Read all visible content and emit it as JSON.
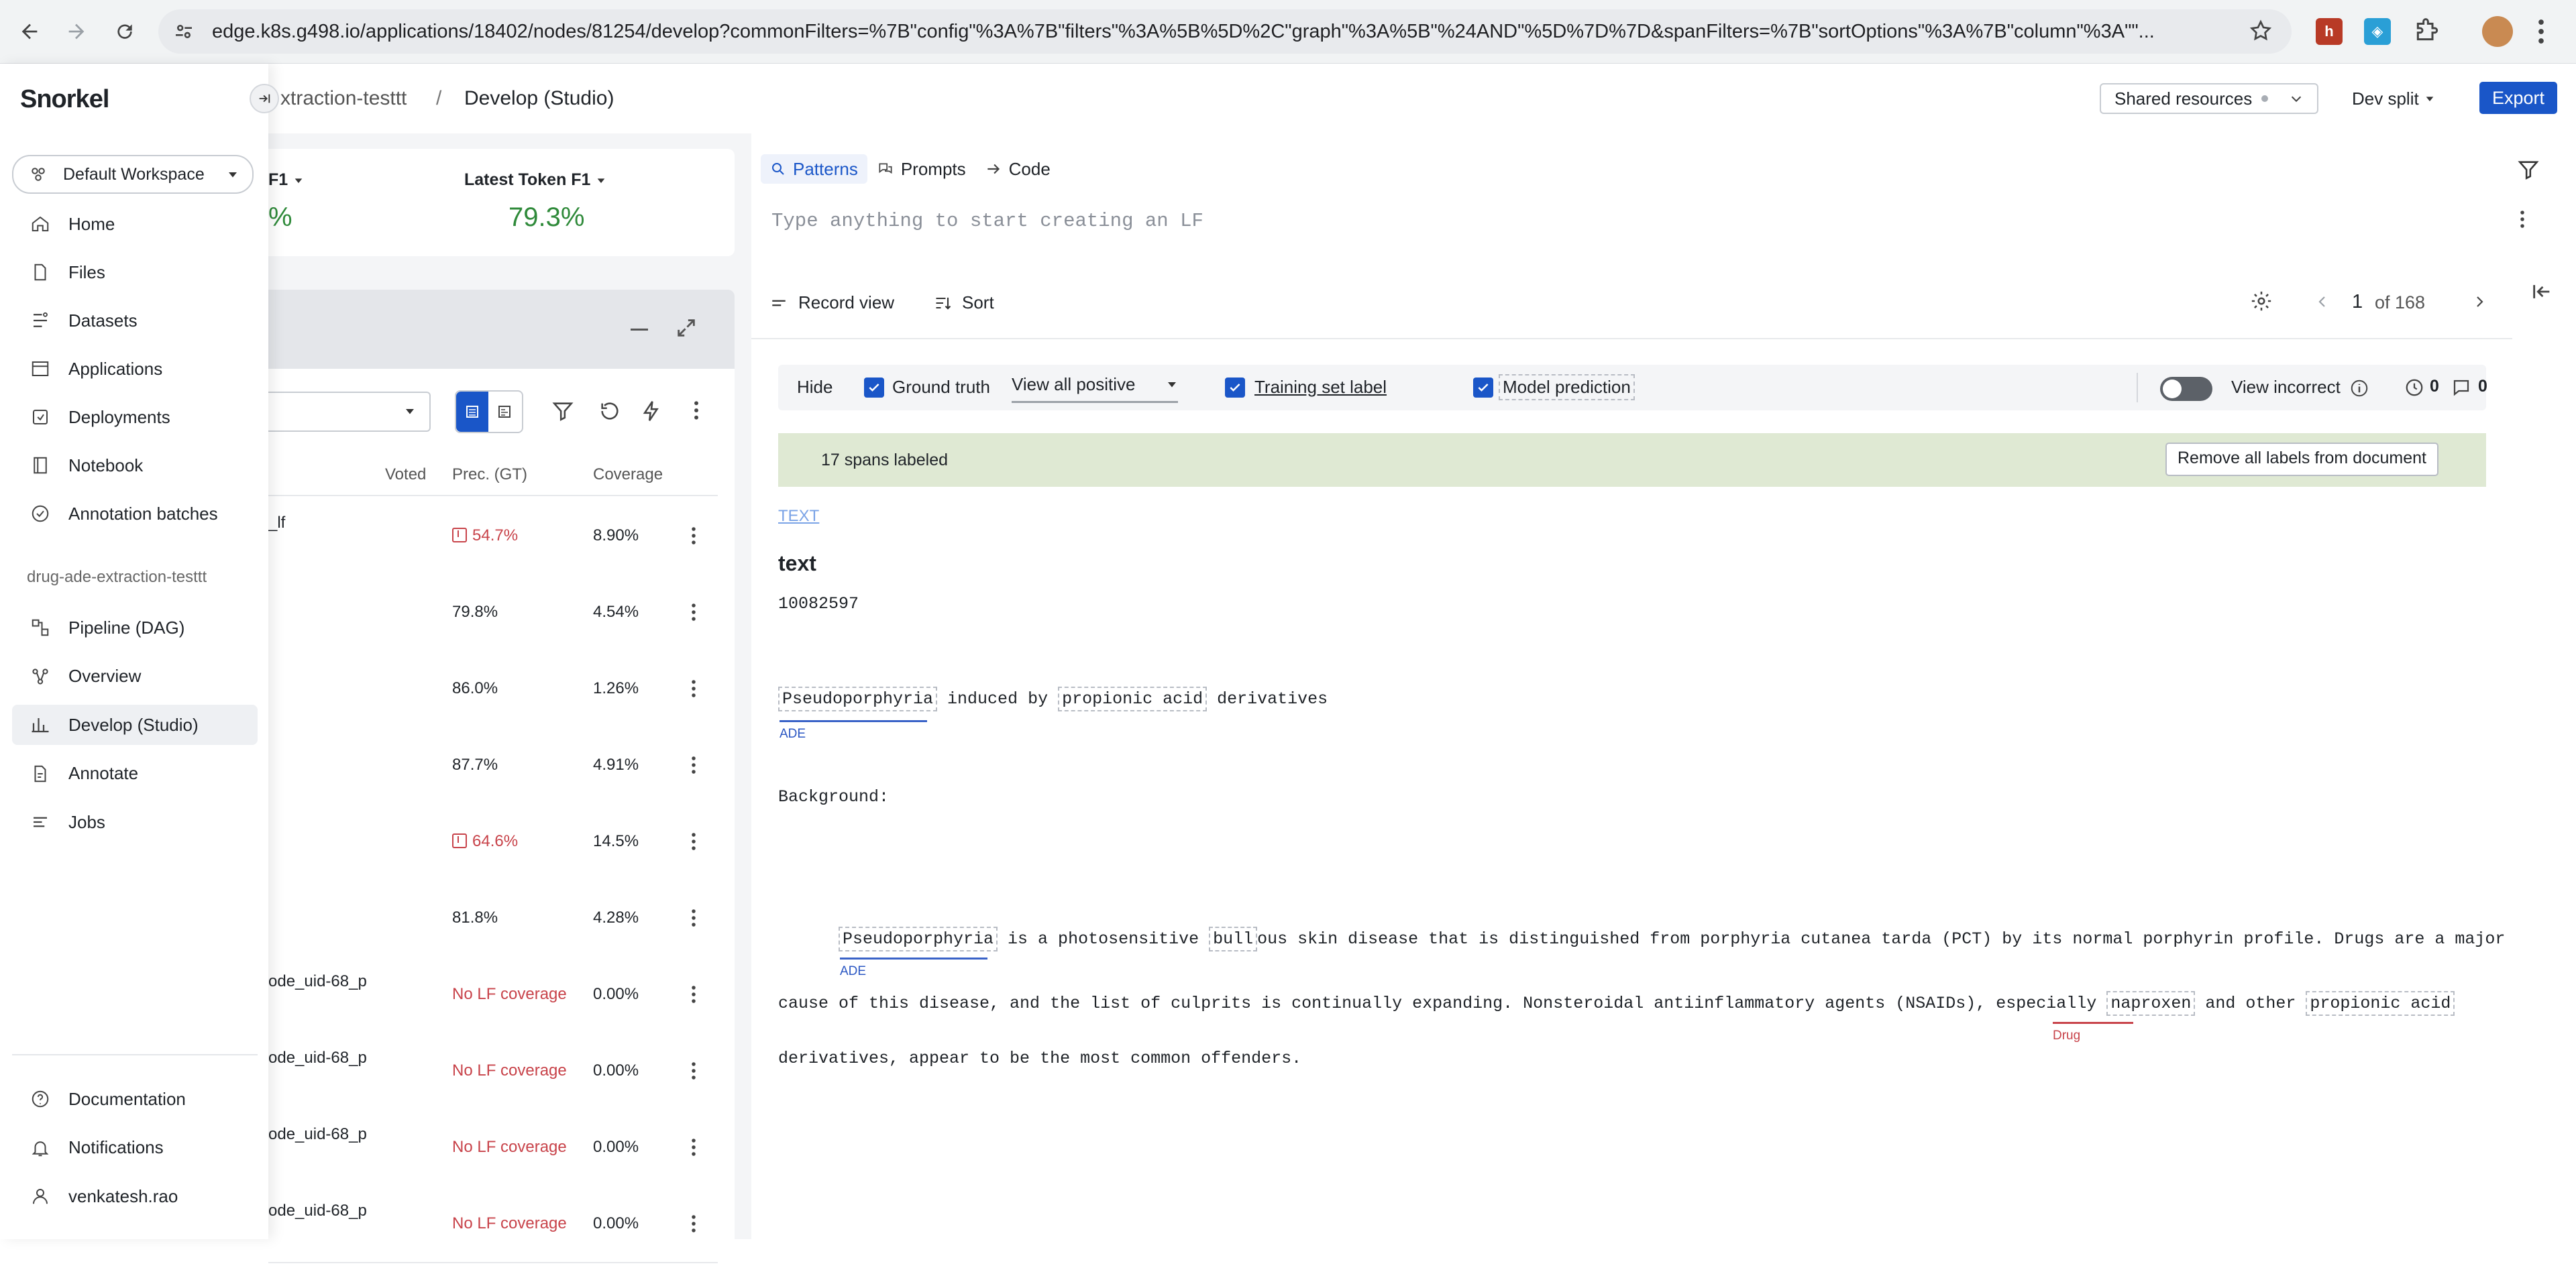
{
  "browser": {
    "url": "edge.k8s.g498.io/applications/18402/nodes/81254/develop?commonFilters=%7B\"config\"%3A%7B\"filters\"%3A%5B%5D%2C\"graph\"%3A%5B\"%24AND\"%5D%7D%7D&spanFilters=%7B\"sortOptions\"%3A%7B\"column\"%3A\"\"..."
  },
  "brand": {
    "logo": "Snorkel"
  },
  "header": {
    "breadcrumb_parent": "xtraction-testtt",
    "separator": "/",
    "breadcrumb_current": "Develop (Studio)",
    "shared_resources": "Shared resources",
    "split": "Dev split",
    "export": "Export"
  },
  "sidenav": {
    "workspace": "Default Workspace",
    "items": [
      {
        "label": "Home",
        "icon": "home-icon"
      },
      {
        "label": "Files",
        "icon": "file-icon"
      },
      {
        "label": "Datasets",
        "icon": "datasets-icon"
      },
      {
        "label": "Applications",
        "icon": "window-icon"
      },
      {
        "label": "Deployments",
        "icon": "deploy-icon"
      },
      {
        "label": "Notebook",
        "icon": "notebook-icon"
      },
      {
        "label": "Annotation batches",
        "icon": "check-circle-icon"
      }
    ],
    "app_name": "drug-ade-extraction-testtt",
    "app_items": [
      {
        "label": "Pipeline (DAG)",
        "icon": "dag-icon"
      },
      {
        "label": "Overview",
        "icon": "overview-icon"
      },
      {
        "label": "Develop (Studio)",
        "icon": "develop-icon",
        "active": true
      },
      {
        "label": "Annotate",
        "icon": "annotate-icon"
      },
      {
        "label": "Jobs",
        "icon": "jobs-icon"
      }
    ],
    "footer": [
      {
        "label": "Documentation",
        "icon": "help-icon"
      },
      {
        "label": "Notifications",
        "icon": "bell-icon"
      },
      {
        "label": "venkatesh.rao",
        "icon": "user-icon"
      }
    ]
  },
  "metrics": {
    "first_label": "F1",
    "first_value": "%",
    "latest_label": "Latest Token F1",
    "latest_value": "79.3%"
  },
  "lf_table": {
    "columns": [
      "Voted",
      "Prec. (GT)",
      "Coverage"
    ],
    "rows": [
      {
        "name": "_lf",
        "voted": "",
        "precision": "54.7%",
        "coverage": "8.90%",
        "warn": true
      },
      {
        "name": "",
        "voted": "",
        "precision": "79.8%",
        "coverage": "4.54%",
        "warn": false
      },
      {
        "name": "",
        "voted": "",
        "precision": "86.0%",
        "coverage": "1.26%",
        "warn": false
      },
      {
        "name": "",
        "voted": "",
        "precision": "87.7%",
        "coverage": "4.91%",
        "warn": false
      },
      {
        "name": "",
        "voted": "",
        "precision": "64.6%",
        "coverage": "14.5%",
        "warn": true
      },
      {
        "name": "",
        "voted": "",
        "precision": "81.8%",
        "coverage": "4.28%",
        "warn": false
      },
      {
        "name": "ode_uid-68_p",
        "voted": "",
        "precision": "No LF coverage",
        "coverage": "0.00%",
        "warn": false,
        "none": true
      },
      {
        "name": "ode_uid-68_p",
        "voted": "",
        "precision": "No LF coverage",
        "coverage": "0.00%",
        "warn": false,
        "none": true
      },
      {
        "name": "ode_uid-68_p",
        "voted": "",
        "precision": "No LF coverage",
        "coverage": "0.00%",
        "warn": false,
        "none": true
      },
      {
        "name": "ode_uid-68_p",
        "voted": "",
        "precision": "No LF coverage",
        "coverage": "0.00%",
        "warn": false,
        "none": true
      }
    ]
  },
  "lf_builder": {
    "tabs": [
      "Patterns",
      "Prompts",
      "Code"
    ],
    "placeholder": "Type anything to start creating an LF"
  },
  "record": {
    "record_view": "Record view",
    "sort": "Sort",
    "page": "1",
    "of": "of 168",
    "hide": "Hide",
    "ground_truth": "Ground truth",
    "view_all": "View all positive",
    "training_label": "Training set label",
    "model_prediction": "Model prediction",
    "view_incorrect": "View incorrect",
    "count_a": "0",
    "count_b": "0",
    "banner": "17 spans labeled",
    "remove_all": "Remove all labels from document",
    "field_link": "TEXT",
    "field_title": "text",
    "doc_id": "10082597",
    "title_span1": "Pseudoporphyria",
    "title_mid": " induced by ",
    "title_span2": "propionic acid",
    "title_end": " derivatives",
    "tag_ade": "ADE",
    "background": "Background:",
    "p1_span": "Pseudoporphyria",
    "p1_mid": " is a photosensitive ",
    "p1_bull": "bull",
    "p1_rest": "ous skin disease that is distinguished from porphyria cutanea tarda (PCT) by its normal porphyrin profile. Drugs are a major",
    "p2_start": "cause of this disease, and the list of culprits is continually expanding. Nonsteroidal antiinflammatory agents (NSAIDs), especially ",
    "p2_span": "naproxen",
    "p2_mid": " and other ",
    "p2_span2": "propionic acid",
    "tag_drug": "Drug",
    "p3": "derivatives, appear to be the most common offenders."
  }
}
